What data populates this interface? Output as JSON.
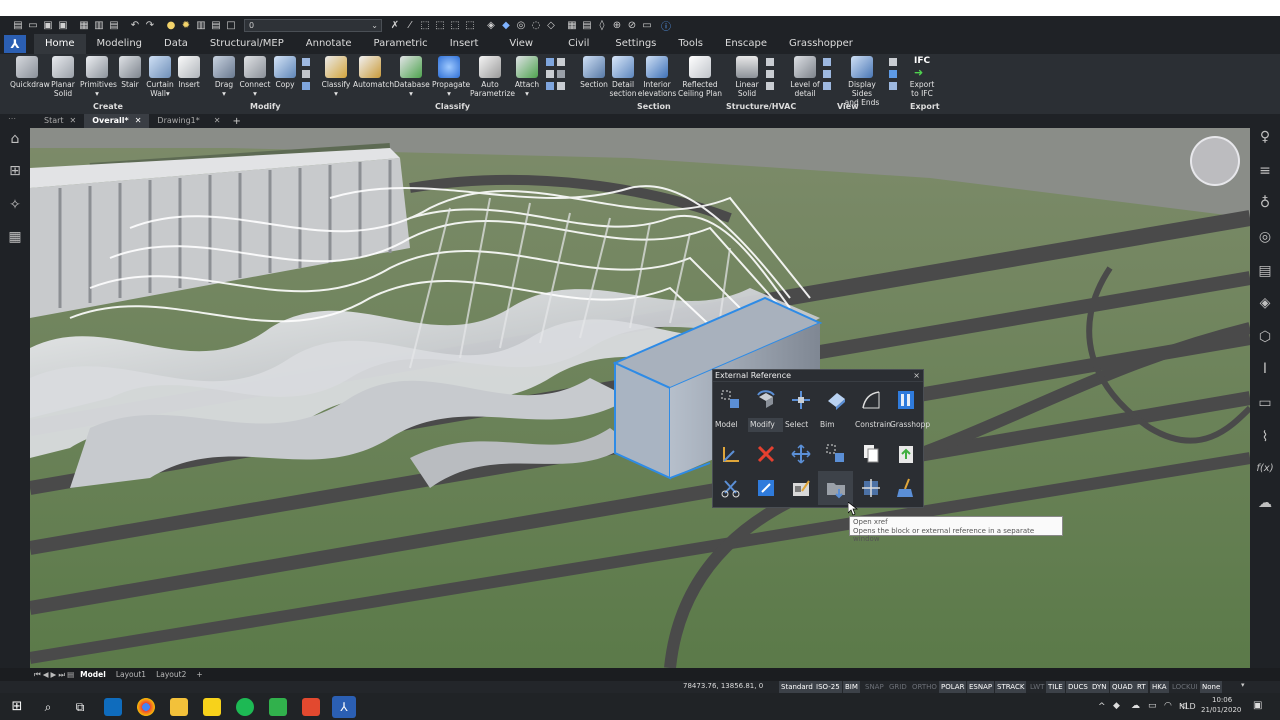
{
  "qat": {
    "dropdown_value": "0"
  },
  "ribbon_tabs": [
    "Home",
    "Modeling",
    "Data",
    "Structural/MEP",
    "Annotate",
    "Parametric",
    "Insert",
    "View",
    "Civil",
    "Settings",
    "Tools",
    "Enscape",
    "Grasshopper"
  ],
  "ribbon": {
    "buttons": [
      {
        "l1": "Quickdraw",
        "l2": ""
      },
      {
        "l1": "Planar",
        "l2": "Solid"
      },
      {
        "l1": "Primitives",
        "l2": "▾"
      },
      {
        "l1": "Stair",
        "l2": ""
      },
      {
        "l1": "Curtain",
        "l2": "Wall▾"
      },
      {
        "l1": "Insert",
        "l2": ""
      },
      {
        "l1": "Drag",
        "l2": "▾"
      },
      {
        "l1": "Connect",
        "l2": "▾"
      },
      {
        "l1": "Copy",
        "l2": ""
      },
      {
        "l1": "Classify",
        "l2": "▾"
      },
      {
        "l1": "Automatch",
        "l2": ""
      },
      {
        "l1": "Database",
        "l2": "▾"
      },
      {
        "l1": "Propagate",
        "l2": "▾"
      },
      {
        "l1": "Auto",
        "l2": "Parametrize"
      },
      {
        "l1": "Attach",
        "l2": "▾"
      },
      {
        "l1": "Section",
        "l2": ""
      },
      {
        "l1": "Detail",
        "l2": "section"
      },
      {
        "l1": "Interior",
        "l2": "elevations"
      },
      {
        "l1": "Reflected",
        "l2": "Ceiling Plan"
      },
      {
        "l1": "Linear",
        "l2": "Solid"
      },
      {
        "l1": "Level of",
        "l2": "detail"
      },
      {
        "l1": "Display Sides",
        "l2": "and Ends"
      },
      {
        "l1": "Export",
        "l2": "to IFC"
      }
    ],
    "groups": [
      "Create",
      "Modify",
      "Classify",
      "Section",
      "Structure/HVAC",
      "View",
      "Export"
    ],
    "ifc_label": "IFC"
  },
  "doc_tabs": [
    "Start",
    "Overall*",
    "Drawing1*"
  ],
  "layout_tabs": [
    "Model",
    "Layout1",
    "Layout2",
    "+"
  ],
  "panel": {
    "title": "External Reference",
    "close": "×",
    "labels": [
      "Model",
      "Modify",
      "Select",
      "Bim",
      "Constrain",
      "Grasshopp"
    ]
  },
  "tooltip": {
    "title": "Open xref",
    "desc": "Opens the block or external reference in a separate window"
  },
  "status": {
    "coords": "78473.76, 13856.81, 0",
    "items": [
      {
        "t": "Standard",
        "on": true
      },
      {
        "t": "ISO-25",
        "on": true
      },
      {
        "t": "BIM",
        "on": true
      },
      {
        "t": "SNAP",
        "on": false
      },
      {
        "t": "GRID",
        "on": false
      },
      {
        "t": "ORTHO",
        "on": false
      },
      {
        "t": "POLAR",
        "on": true
      },
      {
        "t": "ESNAP",
        "on": true
      },
      {
        "t": "STRACK",
        "on": true
      },
      {
        "t": "LWT",
        "on": false
      },
      {
        "t": "TILE",
        "on": true
      },
      {
        "t": "DUCS",
        "on": true
      },
      {
        "t": "DYN",
        "on": true
      },
      {
        "t": "QUAD",
        "on": true
      },
      {
        "t": "RT",
        "on": true
      },
      {
        "t": "HKA",
        "on": true
      },
      {
        "t": "LOCKUI",
        "on": false
      },
      {
        "t": "None",
        "on": true
      }
    ]
  },
  "taskbar": {
    "lang": "NLD",
    "time": "10:06",
    "date": "21/01/2020"
  },
  "colors": {
    "accent": "#2b5fb3",
    "selection": "#2e8be6",
    "ground": "#5d7a4d"
  }
}
